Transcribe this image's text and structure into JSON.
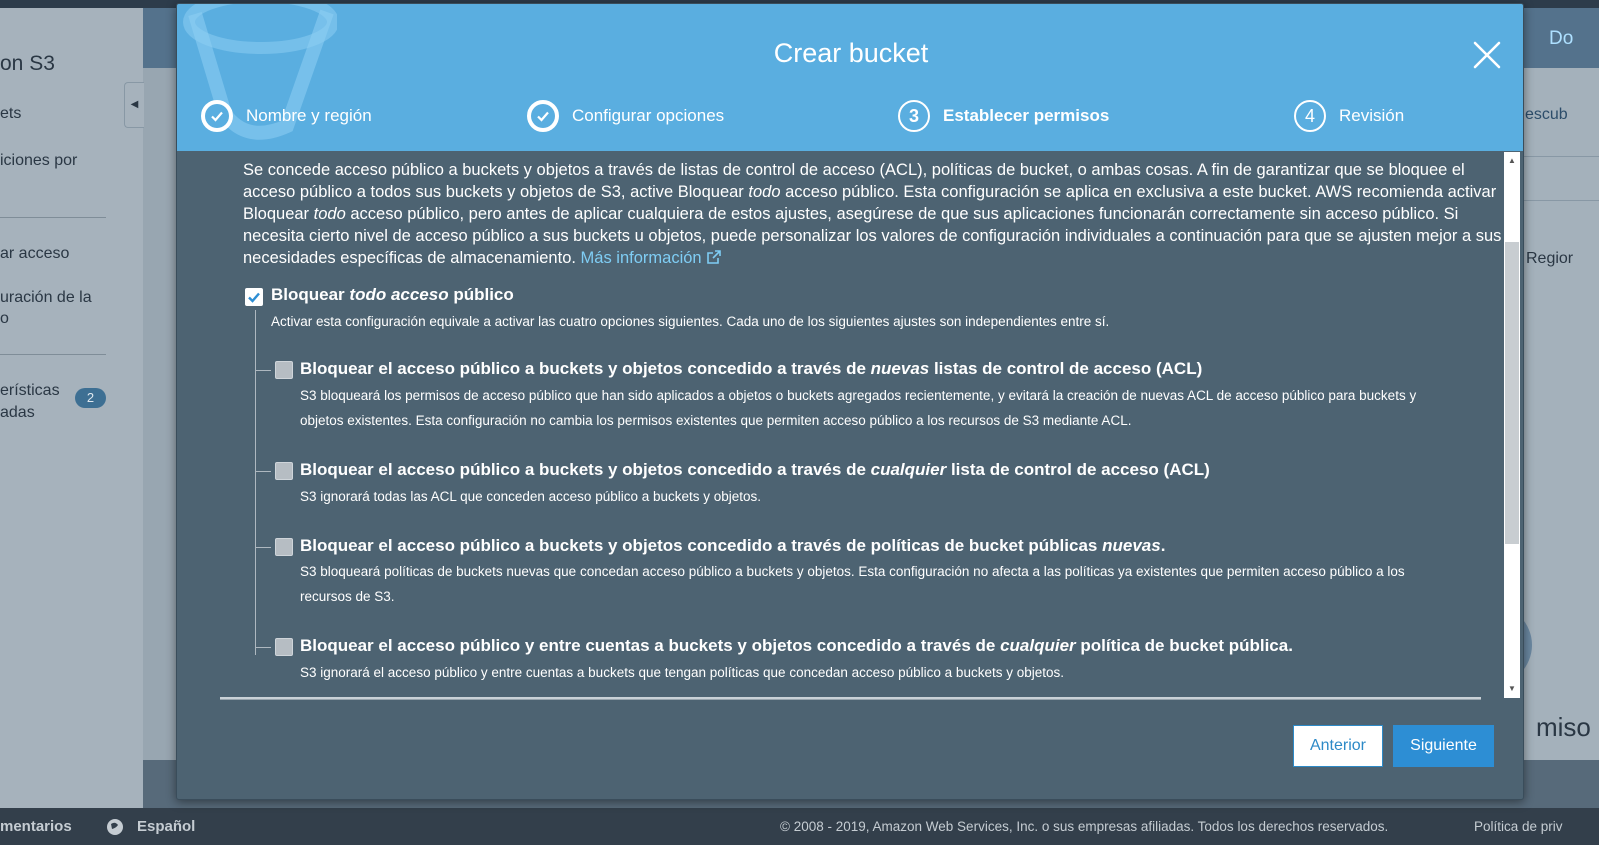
{
  "background": {
    "sidebar": {
      "title": "on S3",
      "items": [
        "ets",
        "iciones por",
        "ar acceso",
        "uración de la",
        "o",
        "erísticas",
        "adas"
      ],
      "badge": "2"
    },
    "header_right": "Do",
    "right_panel": {
      "describe": "escub",
      "region": "Regior",
      "permisos": "miso"
    },
    "footer": {
      "comments": "mentarios",
      "language": "Español",
      "copyright": "© 2008 - 2019, Amazon Web Services, Inc. o sus empresas afiliadas. Todos los derechos reservados.",
      "privacy": "Política de priv"
    }
  },
  "modal": {
    "title": "Crear bucket",
    "steps": [
      {
        "label": "Nombre y región",
        "state": "done"
      },
      {
        "label": "Configurar opciones",
        "state": "done"
      },
      {
        "number": "3",
        "label": "Establecer permisos",
        "state": "active"
      },
      {
        "number": "4",
        "label": "Revisión",
        "state": "pending"
      }
    ],
    "intro": {
      "p1": "Se concede acceso público a buckets y objetos a través de listas de control de acceso (ACL), políticas de bucket, o ambas cosas. A fin de garantizar que se bloquee el acceso público a todos sus buckets y objetos de S3, active Bloquear ",
      "em1": "todo",
      "p2": " acceso público. Esta configuración se aplica en exclusiva a este bucket. AWS recomienda activar Bloquear ",
      "em2": "todo",
      "p3": " acceso público, pero antes de aplicar cualquiera de estos ajustes, asegúrese de que sus aplicaciones funcionarán correctamente sin acceso público. Si necesita cierto nivel de acceso público a sus buckets u objetos, puede personalizar los valores de configuración individuales a continuación para que se ajusten mejor a sus necesidades específicas de almacenamiento. ",
      "link": "Más información"
    },
    "main_option": {
      "label_pre": "Bloquear ",
      "label_em": "todo acceso",
      "label_post": " público",
      "checked": true,
      "description": "Activar esta configuración equivale a activar las cuatro opciones siguientes. Cada uno de los siguientes ajustes son independientes entre sí."
    },
    "sub_options": [
      {
        "title_pre": "Bloquear el acceso público a buckets y objetos concedido a través de ",
        "title_em": "nuevas",
        "title_post": " listas de control de acceso (ACL)",
        "description": "S3 bloqueará los permisos de acceso público que han sido aplicados a objetos o buckets agregados recientemente, y evitará la creación de nuevas ACL de acceso público para buckets y objetos existentes. Esta configuración no cambia los permisos existentes que permiten acceso público a los recursos de S3 mediante ACL.",
        "checked": true
      },
      {
        "title_pre": "Bloquear el acceso público a buckets y objetos concedido a través de ",
        "title_em": "cualquier",
        "title_post": " lista de control de acceso (ACL)",
        "description": "S3 ignorará todas las ACL que conceden acceso público a buckets y objetos.",
        "checked": true
      },
      {
        "title_pre": "Bloquear el acceso público a buckets y objetos concedido a través de políticas de bucket públicas ",
        "title_em": "nuevas",
        "title_post": ".",
        "description": "S3 bloqueará políticas de buckets nuevas que concedan acceso público a buckets y objetos. Esta configuración no afecta a las políticas ya existentes que permiten acceso público a los recursos de S3.",
        "checked": true
      },
      {
        "title_pre": "Bloquear el acceso público y entre cuentas a buckets y objetos concedido a través de ",
        "title_em": "cualquier",
        "title_post": " política de bucket pública.",
        "description": "S3 ignorará el acceso público y entre cuentas a buckets que tengan políticas que concedan acceso público a buckets y objetos.",
        "checked": true
      }
    ],
    "buttons": {
      "previous": "Anterior",
      "next": "Siguiente"
    }
  },
  "colors": {
    "header_blue": "#5aaee0",
    "modal_body": "#4d6372",
    "primary_button": "#2d8ed4",
    "link": "#7fcdf4"
  }
}
